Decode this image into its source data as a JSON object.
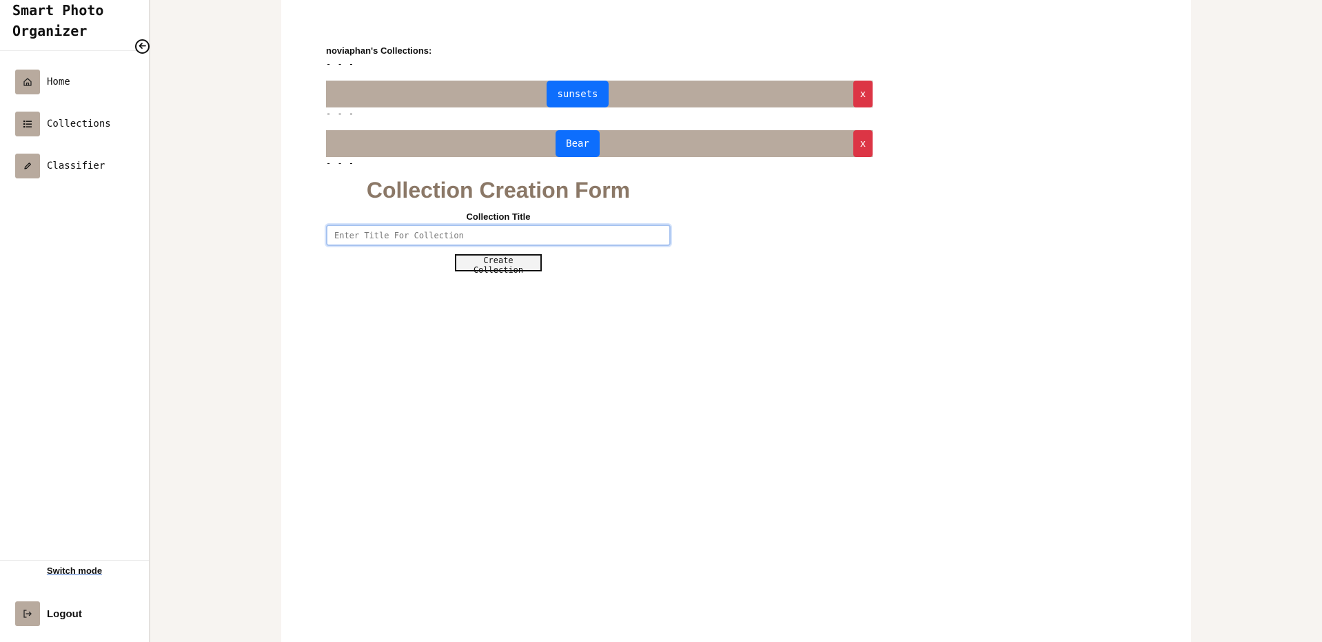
{
  "sidebar": {
    "brand": "Smart Photo Organizer",
    "collapse_icon": "arrow-left-circle-icon",
    "items": [
      {
        "label": "Home",
        "icon": "home-icon"
      },
      {
        "label": "Collections",
        "icon": "list-icon"
      },
      {
        "label": "Classifier",
        "icon": "pencil-icon"
      }
    ],
    "switch_mode": "Switch mode",
    "logout": {
      "label": "Logout",
      "icon": "logout-icon"
    }
  },
  "main": {
    "collections_heading": "noviaphan's Collections:",
    "separator": "- - -",
    "collections": [
      {
        "name": "sunsets",
        "delete_label": "x"
      },
      {
        "name": "Bear",
        "delete_label": "x"
      }
    ],
    "form": {
      "title": "Collection Creation Form",
      "field_label": "Collection Title",
      "input_placeholder": "Enter Title For Collection",
      "input_value": "",
      "submit_label": "Create Collection"
    }
  },
  "colors": {
    "accent_tan": "#b8aa9e",
    "primary_blue": "#0d6efd",
    "danger_red": "#dc3545",
    "title_brown": "#8b7867",
    "page_bg": "#f7f4f1"
  }
}
